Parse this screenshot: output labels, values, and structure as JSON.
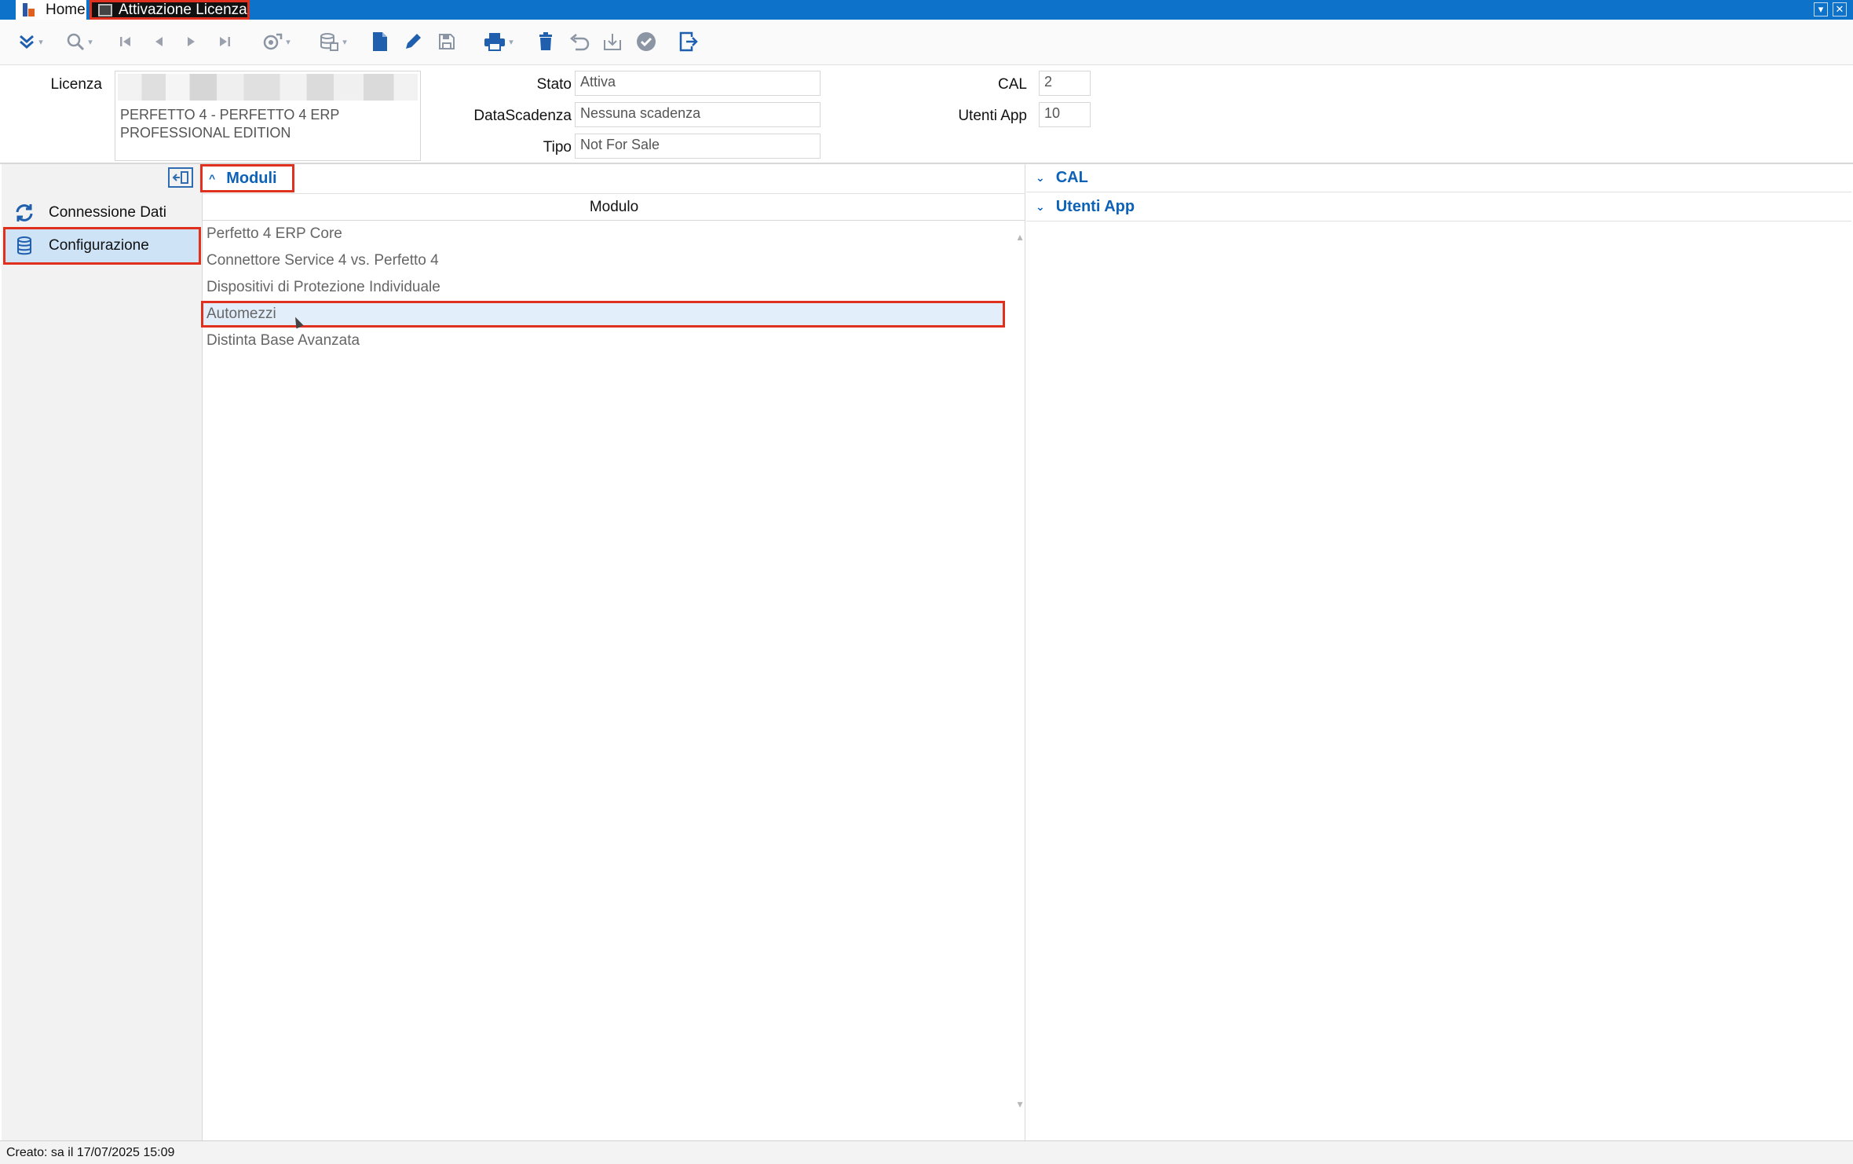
{
  "tabs": {
    "home": "Home",
    "active": "Attivazione Licenza"
  },
  "toolbar": {
    "icons": [
      "expand-menu",
      "search",
      "first-record",
      "previous-record",
      "next-record",
      "last-record",
      "process",
      "database-actions",
      "new-document",
      "edit",
      "save",
      "print",
      "delete",
      "undo",
      "import",
      "confirm",
      "exit"
    ]
  },
  "header": {
    "licenza_label": "Licenza",
    "licenza_description": "PERFETTO 4 - PERFETTO 4 ERP PROFESSIONAL EDITION",
    "stato_label": "Stato",
    "stato_value": "Attiva",
    "datascadenza_label": "DataScadenza",
    "datascadenza_value": "Nessuna scadenza",
    "tipo_label": "Tipo",
    "tipo_value": "Not For Sale",
    "cal_label": "CAL",
    "cal_value": "2",
    "utenti_label": "Utenti App",
    "utenti_value": "10"
  },
  "sidebar": {
    "items": [
      {
        "label": "Connessione Dati",
        "icon": "sync-icon"
      },
      {
        "label": "Configurazione",
        "icon": "database-icon",
        "selected": true
      }
    ]
  },
  "moduli": {
    "title": "Moduli",
    "column_header": "Modulo",
    "rows": [
      "Perfetto 4 ERP Core",
      "Connettore Service 4 vs. Perfetto 4",
      "Dispositivi di Protezione Individuale",
      "Automezzi",
      "Distinta Base Avanzata"
    ],
    "selected_index": 3
  },
  "right_panel": {
    "cal_title": "CAL",
    "utenti_title": "Utenti App"
  },
  "status": {
    "text": "Creato: sa il 17/07/2025 15:09"
  },
  "colors": {
    "accent": "#0d72c9",
    "highlight_border": "#e0301e",
    "selection_bg": "#cfe3f7"
  }
}
